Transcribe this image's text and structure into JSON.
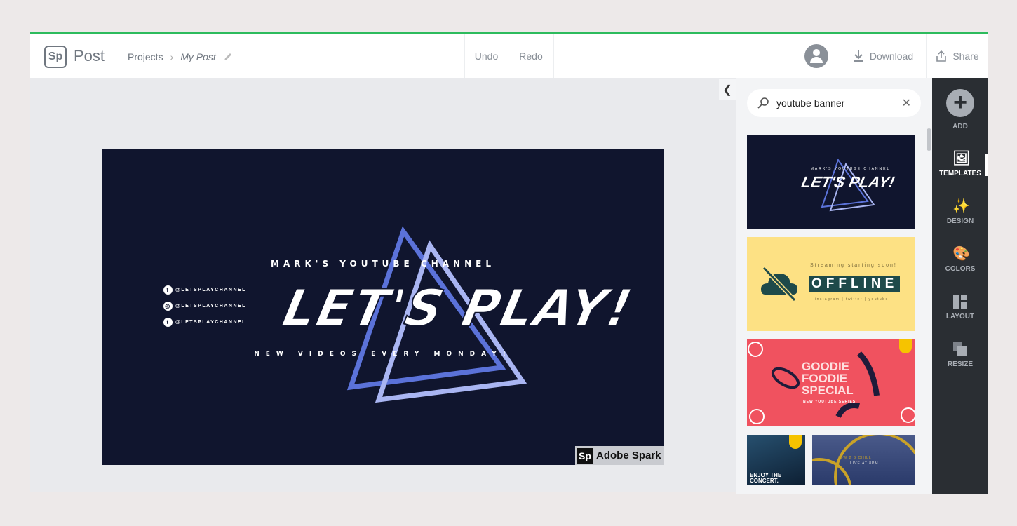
{
  "header": {
    "logo": "Sp",
    "app_name": "Post",
    "breadcrumb": {
      "root": "Projects",
      "separator": "›",
      "current": "My Post"
    },
    "undo": "Undo",
    "redo": "Redo",
    "download": "Download",
    "share": "Share"
  },
  "canvas": {
    "banner": {
      "title_top": "MARK'S YOUTUBE CHANNEL",
      "headline": "LET'S PLAY!",
      "subtitle": "NEW VIDEOS EVERY MONDAY!",
      "socials": [
        {
          "icon": "facebook-icon",
          "handle": "@LETSPLAYCHANNEL"
        },
        {
          "icon": "instagram-icon",
          "handle": "@LETSPLAYCHANNEL"
        },
        {
          "icon": "twitter-icon",
          "handle": "@LETSPLAYCHANNEL"
        }
      ],
      "background": "#10152e",
      "triangle_colors": [
        "#5b72d9",
        "#a9b5f2"
      ]
    },
    "watermark": "Adobe Spark"
  },
  "panel": {
    "search": {
      "value": "youtube banner",
      "icon": "search-icon"
    },
    "templates": [
      {
        "headline": "LET'S PLAY!",
        "top": "MARK'S YOUTUBE CHANNEL"
      },
      {
        "top": "Streaming starting soon!",
        "headline": "OFFLINE",
        "bottom": "instagram | twitter | youtube"
      },
      {
        "headline": "GOODIE FOODIE SPECIAL",
        "bottom": "NEW YOUTUBE SERIES",
        "premium": true
      },
      {
        "headline": "ENJOY THE CONCERT.",
        "premium": true
      },
      {
        "headline": "HOW 2 B CHILL",
        "bottom": "LIVE AT 8PM"
      }
    ]
  },
  "rail": {
    "items": [
      {
        "label": "ADD"
      },
      {
        "label": "TEMPLATES",
        "active": true
      },
      {
        "label": "DESIGN"
      },
      {
        "label": "COLORS"
      },
      {
        "label": "LAYOUT"
      },
      {
        "label": "RESIZE"
      }
    ]
  },
  "colors": {
    "accent": "#2dbb5d",
    "rail": "#2a2e33",
    "premium": "#f6c300"
  }
}
